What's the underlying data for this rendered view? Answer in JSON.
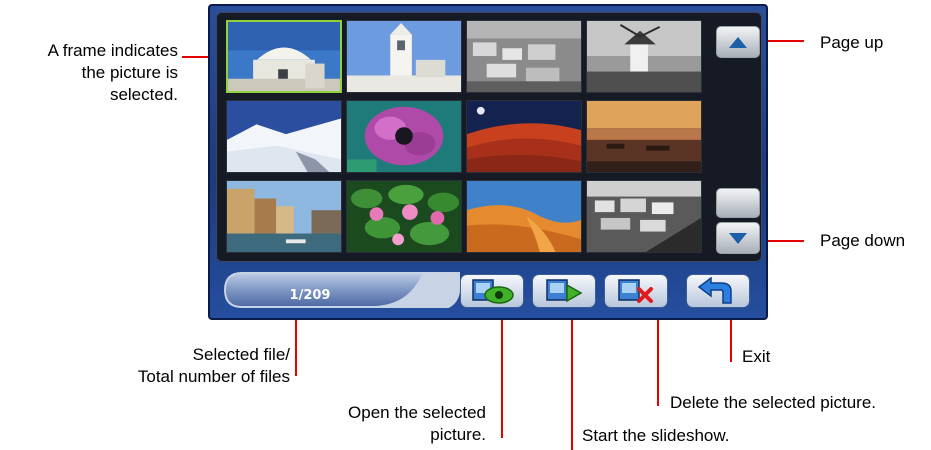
{
  "callouts": {
    "frame_line1": "A frame indicates",
    "frame_line2": "the picture is",
    "frame_line3": "selected.",
    "page_up": "Page up",
    "page_down": "Page down",
    "selected_line1": "Selected file/",
    "selected_line2": "Total number of files",
    "exit": "Exit",
    "delete": "Delete the selected picture.",
    "open_line1": "Open the selected",
    "open_line2": "picture.",
    "slideshow": "Start the slideshow."
  },
  "counter": {
    "text": "1/209"
  },
  "thumbnails": [
    {
      "scene": "white chapel dome on blue sky",
      "selected": true
    },
    {
      "scene": "white church bell tower"
    },
    {
      "scene": "grey hillside village"
    },
    {
      "scene": "windmill on hill"
    },
    {
      "scene": "snowy mountain slope"
    },
    {
      "scene": "purple anemone flower"
    },
    {
      "scene": "red desert dunes at night"
    },
    {
      "scene": "harbour at sunset"
    },
    {
      "scene": "canal with buildings"
    },
    {
      "scene": "pink water lilies"
    },
    {
      "scene": "orange sand dune"
    },
    {
      "scene": "grey coastal town"
    }
  ],
  "toolbar": {
    "open_icon": "eye-picture-icon",
    "slideshow_icon": "play-picture-icon",
    "delete_icon": "delete-picture-icon",
    "exit_icon": "back-arrow-icon"
  },
  "colors": {
    "leader": "#e60000",
    "selection_frame": "#8fd13f",
    "screen": "#1d3b7d"
  }
}
